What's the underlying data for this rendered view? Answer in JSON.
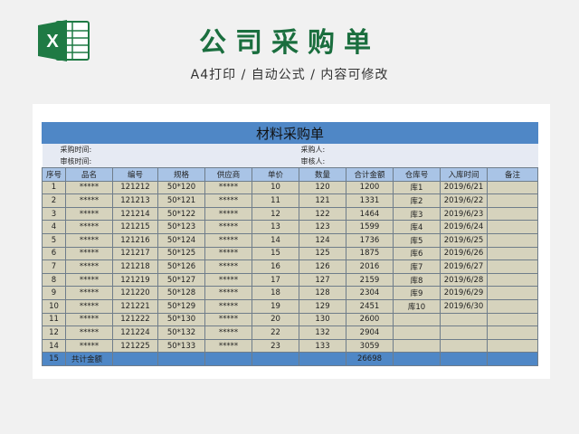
{
  "header": {
    "title": "公司采购单",
    "subtitle": "A4打印 / 自动公式 / 内容可修改",
    "excel_icon_letter": "X"
  },
  "sheet": {
    "banner_title": "材料采购单",
    "meta": {
      "purchase_time_label": "采购时间:",
      "purchaser_label": "采购人:",
      "review_time_label": "审核时间:",
      "reviewer_label": "审核人:"
    },
    "columns": [
      "序号",
      "品名",
      "编号",
      "规格",
      "供应商",
      "单价",
      "数量",
      "合计金额",
      "仓库号",
      "入库时间",
      "备注"
    ],
    "rows": [
      [
        "1",
        "*****",
        "121212",
        "50*120",
        "*****",
        "10",
        "120",
        "1200",
        "库1",
        "2019/6/21",
        ""
      ],
      [
        "2",
        "*****",
        "121213",
        "50*121",
        "*****",
        "11",
        "121",
        "1331",
        "库2",
        "2019/6/22",
        ""
      ],
      [
        "3",
        "*****",
        "121214",
        "50*122",
        "*****",
        "12",
        "122",
        "1464",
        "库3",
        "2019/6/23",
        ""
      ],
      [
        "4",
        "*****",
        "121215",
        "50*123",
        "*****",
        "13",
        "123",
        "1599",
        "库4",
        "2019/6/24",
        ""
      ],
      [
        "5",
        "*****",
        "121216",
        "50*124",
        "*****",
        "14",
        "124",
        "1736",
        "库5",
        "2019/6/25",
        ""
      ],
      [
        "6",
        "*****",
        "121217",
        "50*125",
        "*****",
        "15",
        "125",
        "1875",
        "库6",
        "2019/6/26",
        ""
      ],
      [
        "7",
        "*****",
        "121218",
        "50*126",
        "*****",
        "16",
        "126",
        "2016",
        "库7",
        "2019/6/27",
        ""
      ],
      [
        "8",
        "*****",
        "121219",
        "50*127",
        "*****",
        "17",
        "127",
        "2159",
        "库8",
        "2019/6/28",
        ""
      ],
      [
        "9",
        "*****",
        "121220",
        "50*128",
        "*****",
        "18",
        "128",
        "2304",
        "库9",
        "2019/6/29",
        ""
      ],
      [
        "10",
        "*****",
        "121221",
        "50*129",
        "*****",
        "19",
        "129",
        "2451",
        "库10",
        "2019/6/30",
        ""
      ],
      [
        "11",
        "*****",
        "121222",
        "50*130",
        "*****",
        "20",
        "130",
        "2600",
        "",
        "",
        ""
      ],
      [
        "12",
        "*****",
        "121224",
        "50*132",
        "*****",
        "22",
        "132",
        "2904",
        "",
        "",
        ""
      ],
      [
        "14",
        "*****",
        "121225",
        "50*133",
        "*****",
        "23",
        "133",
        "3059",
        "",
        "",
        ""
      ]
    ],
    "total": {
      "index": "15",
      "label": "共计金额",
      "amount": "26698"
    }
  },
  "colors": {
    "title_green": "#1a6e3e",
    "banner_blue": "#4f87c6",
    "header_blue": "#a9c4e6",
    "body_khaki": "#d6d3bd",
    "excel_green": "#1f7a44"
  }
}
